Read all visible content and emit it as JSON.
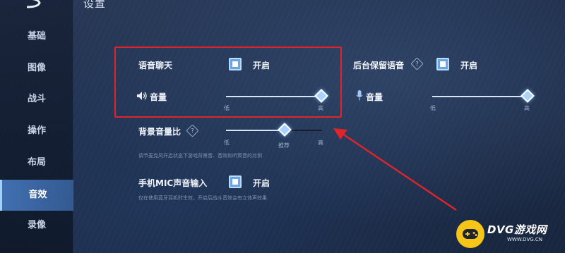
{
  "header": {
    "title": "设置"
  },
  "sidebar": {
    "items": [
      {
        "label": "基础",
        "active": false
      },
      {
        "label": "图像",
        "active": false
      },
      {
        "label": "战斗",
        "active": false
      },
      {
        "label": "操作",
        "active": false
      },
      {
        "label": "布局",
        "active": false
      },
      {
        "label": "音效",
        "active": true
      },
      {
        "label": "录像",
        "active": false
      }
    ]
  },
  "voice_chat": {
    "label": "语音聊天",
    "toggle_label": "开启",
    "checked": true
  },
  "voice_volume": {
    "label": "音量",
    "min_label": "低",
    "max_label": "高",
    "value": 1.0
  },
  "background_keep": {
    "label": "后台保留语音",
    "help": "?",
    "toggle_label": "开启",
    "checked": true
  },
  "mic_volume": {
    "label": "音量",
    "min_label": "低",
    "max_label": "高",
    "value": 1.0
  },
  "bg_ratio": {
    "label": "背景音量比",
    "help": "?",
    "min_label": "低",
    "recommend_label": "推荐",
    "max_label": "高",
    "value": 0.61,
    "hint": "调节麦克风开启状态下游戏背景音、音效和听筒音的比例"
  },
  "mic_input": {
    "label": "手机MIC声音输入",
    "toggle_label": "开启",
    "checked": true,
    "hint": "仅在使用蓝牙耳机时生效，开启后战斗音效会有立体声效果"
  },
  "watermark": {
    "brand": "DVG游戏网",
    "url": "WWW.DVG.CN"
  },
  "colors": {
    "accent": "#6aa6e6",
    "highlight": "#e0242a",
    "brand": "#f5c518"
  }
}
